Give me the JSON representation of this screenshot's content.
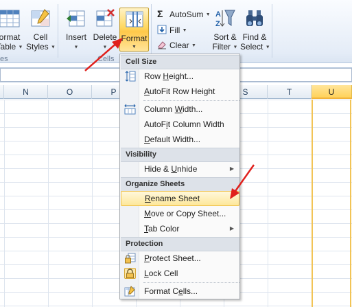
{
  "ribbon": {
    "format_table": {
      "line1": "ormat",
      "line2": "Table"
    },
    "cell_styles": {
      "line1": "Cell",
      "line2": "Styles"
    },
    "styles_group_label": "es",
    "insert_label": "Insert",
    "delete_label": "Delete",
    "format_label": "Format",
    "cells_group_label": "Cells",
    "autosum_label": "AutoSum",
    "fill_label": "Fill",
    "clear_label": "Clear",
    "sort_filter": {
      "line1": "Sort &",
      "line2": "Filter"
    },
    "find_select": {
      "line1": "Find &",
      "line2": "Select"
    }
  },
  "columns": [
    {
      "label": "N"
    },
    {
      "label": "O"
    },
    {
      "label": "P"
    },
    {
      "label": "S"
    },
    {
      "label": "T"
    },
    {
      "label": "U"
    }
  ],
  "menu": {
    "sections": {
      "cell_size": "Cell Size",
      "visibility": "Visibility",
      "organize": "Organize Sheets",
      "protection": "Protection"
    },
    "items": {
      "row_height": {
        "pre": "Row ",
        "ul": "H",
        "post": "eight..."
      },
      "autofit_row": {
        "pre": "",
        "ul": "A",
        "post": "utoFit Row Height"
      },
      "column_width": {
        "pre": "Column ",
        "ul": "W",
        "post": "idth..."
      },
      "autofit_col": {
        "pre": "AutoF",
        "ul": "i",
        "post": "t Column Width"
      },
      "default_width": {
        "pre": "",
        "ul": "D",
        "post": "efault Width..."
      },
      "hide_unhide": {
        "pre": "Hide & ",
        "ul": "U",
        "post": "nhide"
      },
      "rename_sheet": {
        "pre": "",
        "ul": "R",
        "post": "ename Sheet"
      },
      "move_copy": {
        "pre": "",
        "ul": "M",
        "post": "ove or Copy Sheet..."
      },
      "tab_color": {
        "pre": "",
        "ul": "T",
        "post": "ab Color"
      },
      "protect_sheet": {
        "pre": "",
        "ul": "P",
        "post": "rotect Sheet..."
      },
      "lock_cell": {
        "pre": "",
        "ul": "L",
        "post": "ock Cell"
      },
      "format_cells": {
        "pre": "Format C",
        "ul": "e",
        "post": "lls..."
      }
    }
  },
  "colors": {
    "highlight_border": "#f0c24a",
    "annotation_arrow": "#e0201c",
    "selected_column": "#ffd35a"
  }
}
